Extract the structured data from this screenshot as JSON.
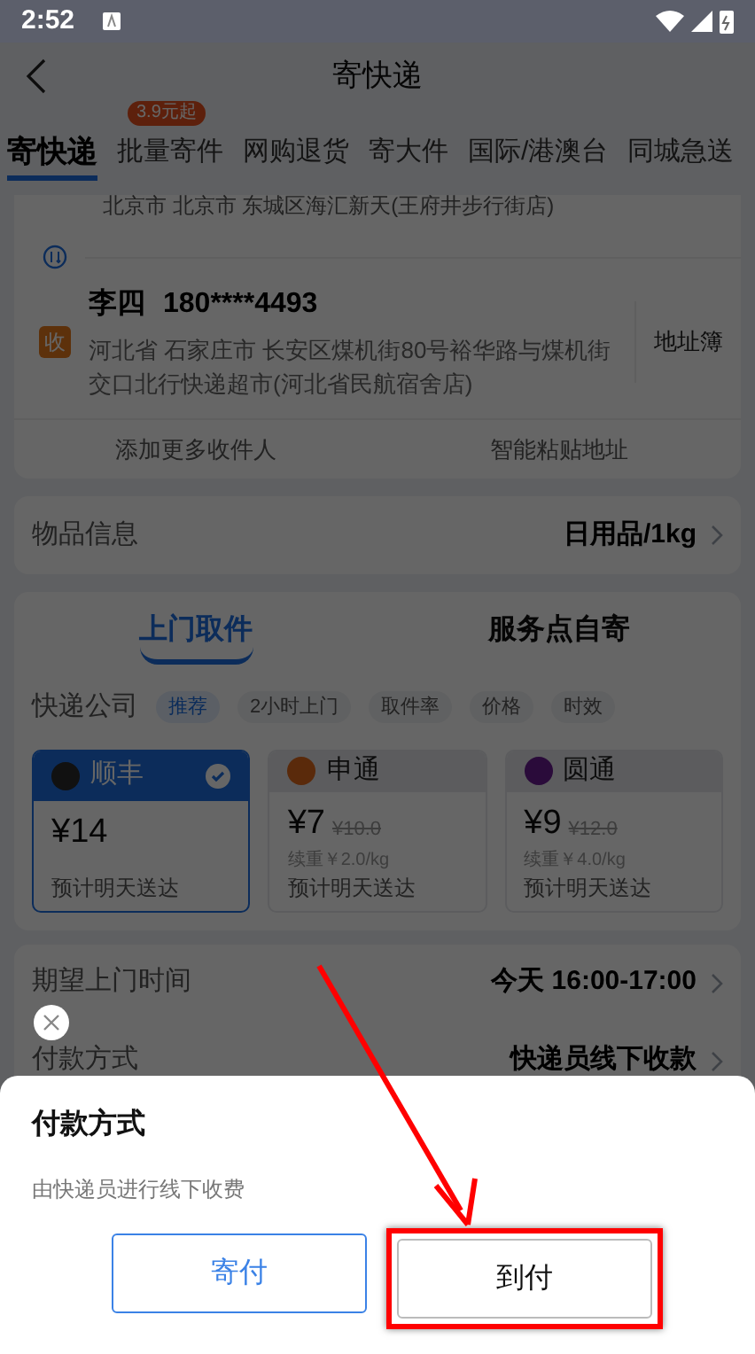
{
  "status_bar": {
    "time": "2:52"
  },
  "header": {
    "title": "寄快递"
  },
  "tabs": [
    {
      "label": "寄快递",
      "selected": true
    },
    {
      "label": "批量寄件",
      "selected": false,
      "badge": "3.9元起"
    },
    {
      "label": "网购退货",
      "selected": false
    },
    {
      "label": "寄大件",
      "selected": false
    },
    {
      "label": "国际/港澳台",
      "selected": false
    },
    {
      "label": "同城急送",
      "selected": false
    }
  ],
  "sender": {
    "address": "北京市 北京市 东城区海汇新天(王府井步行街店)"
  },
  "receiver": {
    "badge": "收",
    "name": "李四",
    "phone": "180****4493",
    "address": "河北省 石家庄市 长安区煤机街80号裕华路与煤机街交口北行快递超市(河北省民航宿舍店)",
    "address_book": "地址簿"
  },
  "address_actions": [
    "添加更多收件人",
    "智能粘贴地址"
  ],
  "item_info": {
    "label": "物品信息",
    "value": "日用品/1kg"
  },
  "pickup_modes": [
    {
      "label": "上门取件",
      "selected": true
    },
    {
      "label": "服务点自寄",
      "selected": false
    }
  ],
  "courier": {
    "label": "快递公司",
    "filters": [
      {
        "label": "推荐",
        "selected": true
      },
      {
        "label": "2小时上门",
        "selected": false
      },
      {
        "label": "取件率",
        "selected": false
      },
      {
        "label": "价格",
        "selected": false
      },
      {
        "label": "时效",
        "selected": false
      }
    ],
    "carriers": [
      {
        "name": "顺丰",
        "color": "#111111",
        "price": "¥14",
        "eta": "预计明天送达",
        "selected": true
      },
      {
        "name": "申通",
        "color": "#5a2a0b",
        "price": "¥7",
        "original_price": "¥10.0",
        "extra": "续重￥2.0/kg",
        "eta": "预计明天送达",
        "selected": false
      },
      {
        "name": "圆通",
        "color": "#2a0b3a",
        "price": "¥9",
        "original_price": "¥12.0",
        "extra": "续重￥4.0/kg",
        "eta": "预计明天送达",
        "selected": false
      }
    ]
  },
  "rows": [
    {
      "label": "期望上门时间",
      "value": "今天 16:00-17:00"
    },
    {
      "label": "付款方式",
      "value": "快递员线下收款"
    }
  ],
  "payment_sheet": {
    "title": "付款方式",
    "description": "由快递员进行线下收费",
    "options": [
      {
        "label": "寄付",
        "kind": "primary",
        "highlighted": false
      },
      {
        "label": "到付",
        "kind": "plain",
        "highlighted": true
      }
    ]
  }
}
